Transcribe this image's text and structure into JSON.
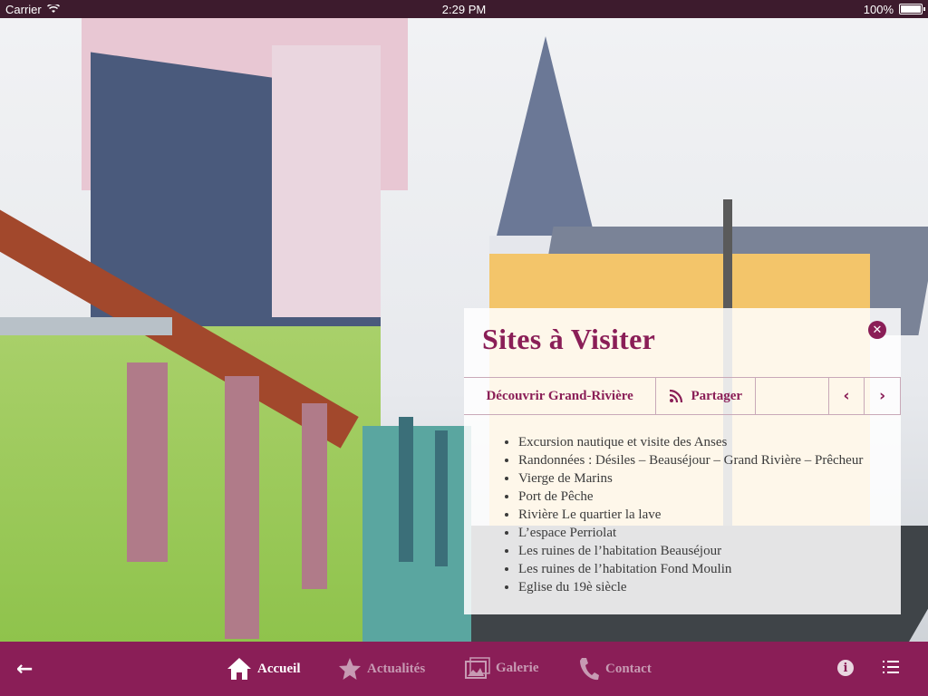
{
  "status_bar": {
    "carrier": "Carrier",
    "time": "2:29 PM",
    "battery": "100%"
  },
  "panel": {
    "title": "Sites à Visiter",
    "toolbar": {
      "discover_label": "Découvrir Grand-Rivière",
      "share_label": "Partager"
    },
    "sites": [
      "Excursion nautique et visite des Anses",
      "Randonnées : Désiles – Beauséjour – Grand Rivière – Prêcheur",
      "Vierge de Marins",
      "Port de Pêche",
      "Rivière Le quartier la lave",
      "L’espace Perriolat",
      "Les ruines de l’habitation Beauséjour",
      "Les ruines de l’habitation Fond Moulin",
      "Eglise du 19è siècle"
    ]
  },
  "bottom_nav": {
    "items": [
      {
        "label": "Accueil",
        "icon": "home-icon",
        "active": true
      },
      {
        "label": "Actualités",
        "icon": "star-icon",
        "active": false
      },
      {
        "label": "Galerie",
        "icon": "gallery-icon",
        "active": false
      },
      {
        "label": "Contact",
        "icon": "phone-icon",
        "active": false
      }
    ]
  },
  "colors": {
    "brand": "#8a1e57",
    "status_bar": "#3d1b2d",
    "inactive_tab": "#c79ab3"
  }
}
